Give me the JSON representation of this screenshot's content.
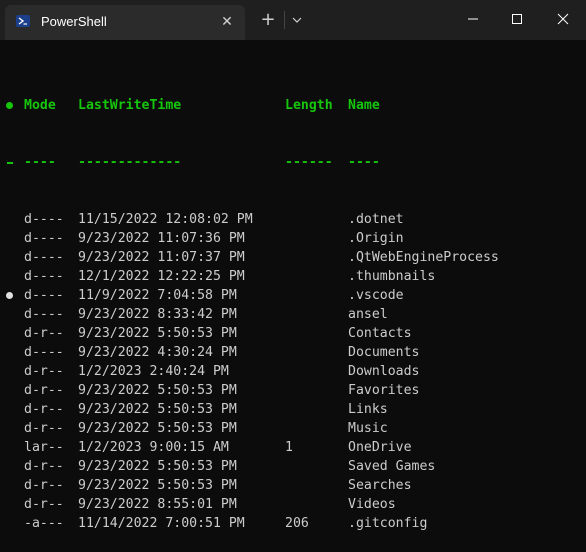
{
  "window": {
    "tab_title": "PowerShell",
    "tab_close": "✕",
    "new_tab": "+",
    "dropdown_icon": "chevron-down-icon",
    "controls": [
      "minimize-icon",
      "maximize-icon",
      "close-icon"
    ]
  },
  "colors": {
    "background": "#0c0c0c",
    "titlebar": "#1f1f1f",
    "tab": "#2b2b2b",
    "header_green": "#16c60c",
    "text": "#cccccc"
  },
  "listing": {
    "headers": {
      "mode": "Mode",
      "time": "LastWriteTime",
      "length": "Length",
      "name": "Name"
    },
    "underlines": {
      "mode": "----",
      "time": "-------------",
      "length": "------",
      "name": "----"
    },
    "rows": [
      {
        "mode": "d----",
        "time": "11/15/2022 12:08:02 PM",
        "length": "",
        "name": ".dotnet",
        "marker": ""
      },
      {
        "mode": "d----",
        "time": "9/23/2022 11:07:36 PM",
        "length": "",
        "name": ".Origin",
        "marker": ""
      },
      {
        "mode": "d----",
        "time": "9/23/2022 11:07:37 PM",
        "length": "",
        "name": ".QtWebEngineProcess",
        "marker": ""
      },
      {
        "mode": "d----",
        "time": "12/1/2022 12:22:25 PM",
        "length": "",
        "name": ".thumbnails",
        "marker": ""
      },
      {
        "mode": "d----",
        "time": "11/9/2022 7:04:58 PM",
        "length": "",
        "name": ".vscode",
        "marker": "white"
      },
      {
        "mode": "d----",
        "time": "9/23/2022 8:33:42 PM",
        "length": "",
        "name": "ansel",
        "marker": ""
      },
      {
        "mode": "d-r--",
        "time": "9/23/2022 5:50:53 PM",
        "length": "",
        "name": "Contacts",
        "marker": ""
      },
      {
        "mode": "d----",
        "time": "9/23/2022 4:30:24 PM",
        "length": "",
        "name": "Documents",
        "marker": ""
      },
      {
        "mode": "d-r--",
        "time": "1/2/2023 2:40:24 PM",
        "length": "",
        "name": "Downloads",
        "marker": ""
      },
      {
        "mode": "d-r--",
        "time": "9/23/2022 5:50:53 PM",
        "length": "",
        "name": "Favorites",
        "marker": ""
      },
      {
        "mode": "d-r--",
        "time": "9/23/2022 5:50:53 PM",
        "length": "",
        "name": "Links",
        "marker": ""
      },
      {
        "mode": "d-r--",
        "time": "9/23/2022 5:50:53 PM",
        "length": "",
        "name": "Music",
        "marker": ""
      },
      {
        "mode": "lar--",
        "time": "1/2/2023 9:00:15 AM",
        "length": "1",
        "name": "OneDrive",
        "marker": ""
      },
      {
        "mode": "d-r--",
        "time": "9/23/2022 5:50:53 PM",
        "length": "",
        "name": "Saved Games",
        "marker": ""
      },
      {
        "mode": "d-r--",
        "time": "9/23/2022 5:50:53 PM",
        "length": "",
        "name": "Searches",
        "marker": ""
      },
      {
        "mode": "d-r--",
        "time": "9/23/2022 8:55:01 PM",
        "length": "",
        "name": "Videos",
        "marker": ""
      },
      {
        "mode": "-a---",
        "time": "11/14/2022 7:00:51 PM",
        "length": "206",
        "name": ".gitconfig",
        "marker": ""
      }
    ]
  }
}
